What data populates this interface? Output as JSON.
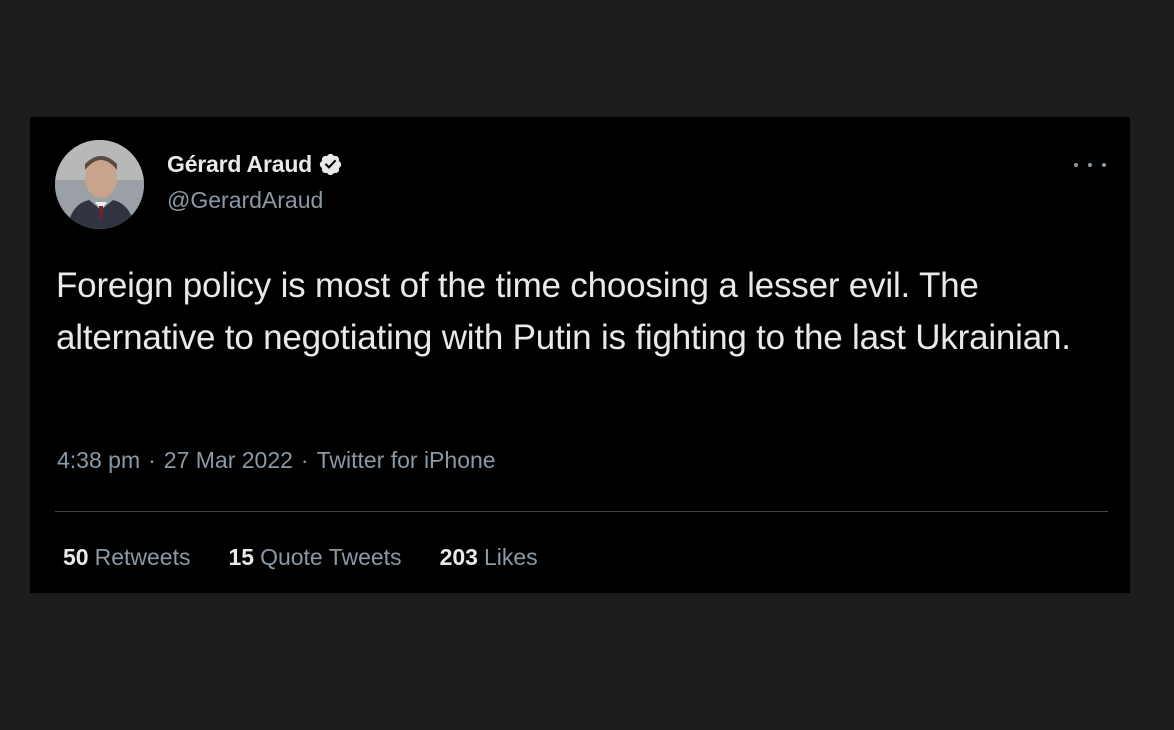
{
  "tweet": {
    "author": {
      "display_name": "Gérard Araud",
      "handle": "@GerardAraud",
      "verified": true,
      "avatar_icon": "profile-photo"
    },
    "text": "Foreign policy is most of the time choosing a lesser evil. The alternative to negotiating with Putin is fighting to the last Ukrainian.",
    "time": "4:38 pm",
    "date": "27 Mar 2022",
    "source": "Twitter for iPhone",
    "separator": "·",
    "stats": {
      "retweets": {
        "count": "50",
        "label": "Retweets"
      },
      "quote_tweets": {
        "count": "15",
        "label": "Quote Tweets"
      },
      "likes": {
        "count": "203",
        "label": "Likes"
      }
    }
  },
  "icons": {
    "verified": "verified-badge-icon",
    "more": "more-options-icon"
  },
  "colors": {
    "page_background": "#1c1c1e",
    "card_background": "#000000",
    "primary_text": "#e7e9ea",
    "secondary_text": "#8b98a5",
    "divider": "#3d4347"
  }
}
